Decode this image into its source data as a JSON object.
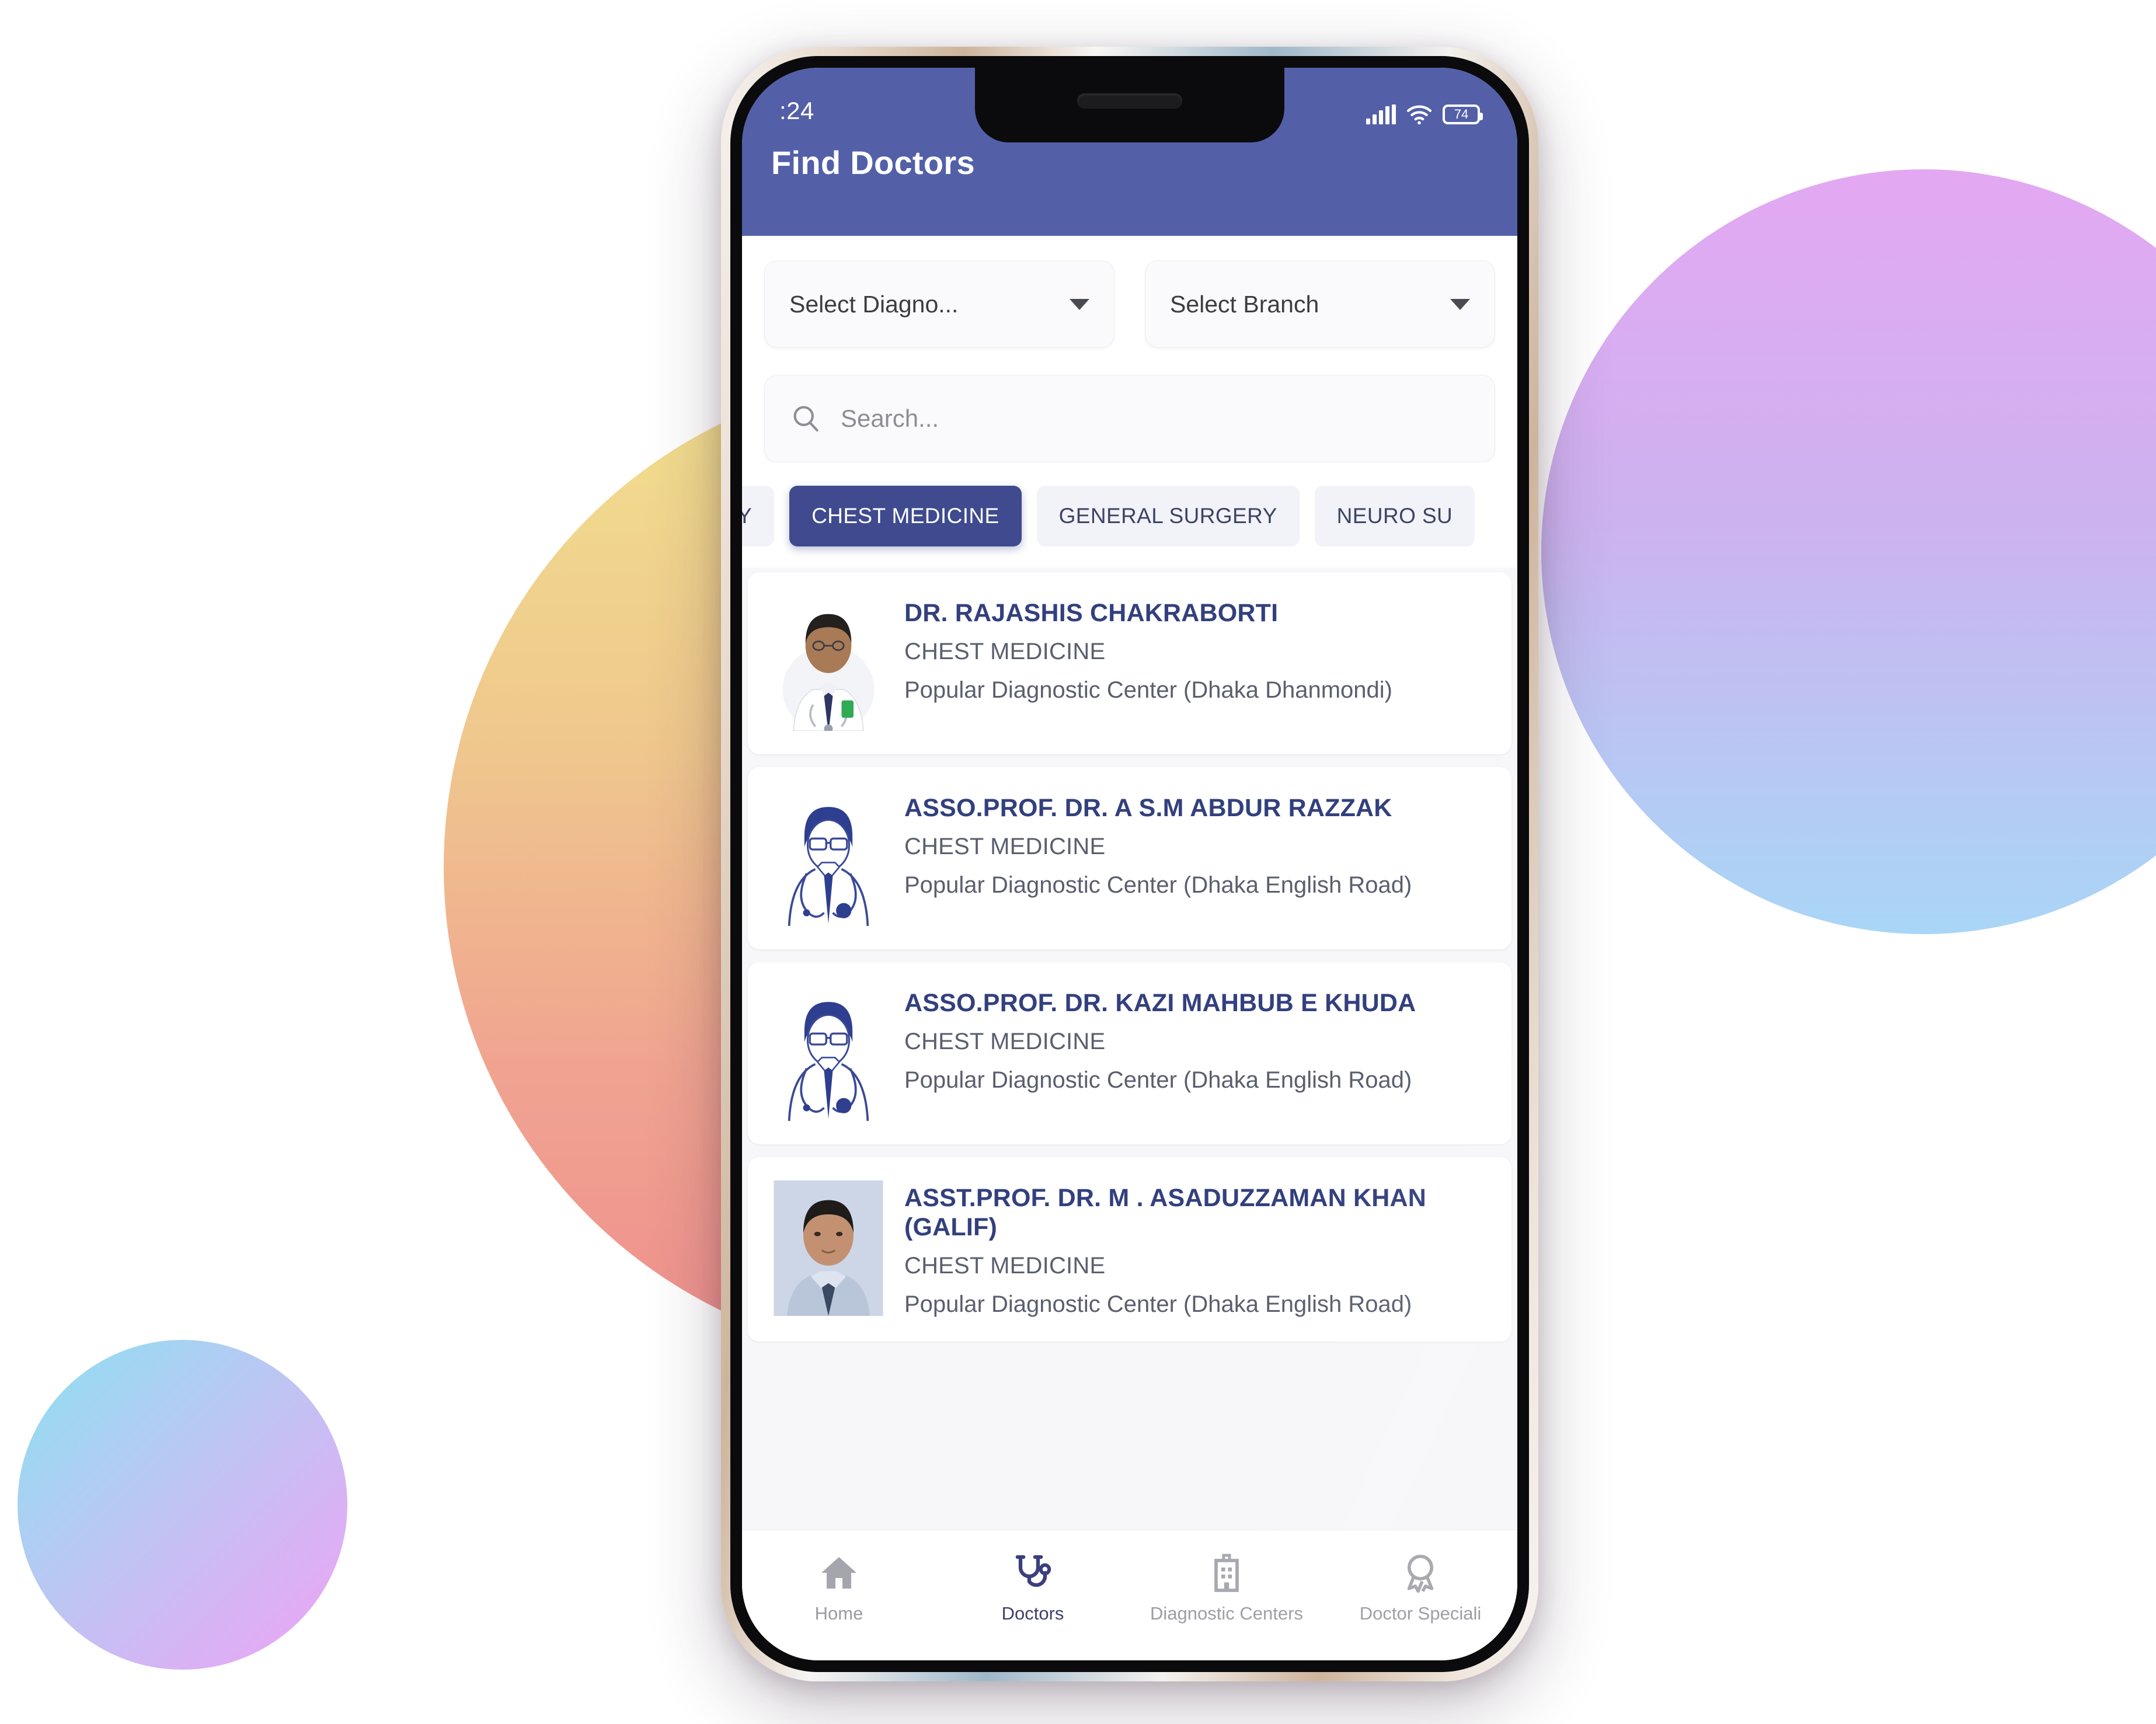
{
  "background": {
    "blobs": [
      {
        "name": "center-gradient-circle",
        "from": "#f2e08e",
        "to": "#ef8f8e"
      },
      {
        "name": "right-gradient-circle",
        "from": "#e3a8f2",
        "to": "#a9d6f6"
      },
      {
        "name": "bottom-left-gradient-circle",
        "from": "#8ce1f2",
        "to": "#f0a2f6"
      }
    ]
  },
  "statusbar": {
    "time": ":24",
    "battery_percent": "74",
    "signal_icon": "cellular-signal-icon",
    "wifi_icon": "wifi-icon",
    "battery_icon": "battery-icon"
  },
  "appbar": {
    "title": "Find Doctors",
    "color": "#5360a8"
  },
  "filters": {
    "diagnostic_dropdown": {
      "label": "Select Diagno...",
      "caret_icon": "chevron-down-icon"
    },
    "branch_dropdown": {
      "label": "Select Branch",
      "caret_icon": "chevron-down-icon"
    },
    "search": {
      "placeholder": "Search...",
      "value": "",
      "icon": "search-icon"
    }
  },
  "chips": {
    "active_color": "#3f4a8f",
    "items": [
      {
        "label": "Y",
        "active": false
      },
      {
        "label": "CHEST MEDICINE",
        "active": true
      },
      {
        "label": "GENERAL SURGERY",
        "active": false
      },
      {
        "label": "NEURO SU",
        "active": false
      }
    ]
  },
  "doctors": [
    {
      "name": "DR. RAJASHIS CHAKRABORTI",
      "specialty": "CHEST MEDICINE",
      "center": "Popular Diagnostic Center (Dhaka Dhanmondi)",
      "avatar": "photo"
    },
    {
      "name": "ASSO.PROF. DR. A S.M ABDUR RAZZAK",
      "specialty": "CHEST MEDICINE",
      "center": "Popular Diagnostic Center (Dhaka English Road)",
      "avatar": "illustration"
    },
    {
      "name": "ASSO.PROF. DR. KAZI MAHBUB E KHUDA",
      "specialty": "CHEST MEDICINE",
      "center": "Popular Diagnostic Center (Dhaka English Road)",
      "avatar": "illustration"
    },
    {
      "name": "ASST.PROF. DR. M . ASADUZZAMAN KHAN (GALIF)",
      "specialty": "CHEST MEDICINE",
      "center": "Popular Diagnostic Center (Dhaka English Road)",
      "avatar": "photo"
    }
  ],
  "bottomnav": {
    "items": [
      {
        "label": "Home",
        "icon": "home-icon",
        "active": false
      },
      {
        "label": "Doctors",
        "icon": "stethoscope-icon",
        "active": true
      },
      {
        "label": "Diagnostic Centers",
        "icon": "hospital-building-icon",
        "active": false
      },
      {
        "label": "Doctor Speciali",
        "icon": "award-ribbon-icon",
        "active": false
      }
    ]
  }
}
